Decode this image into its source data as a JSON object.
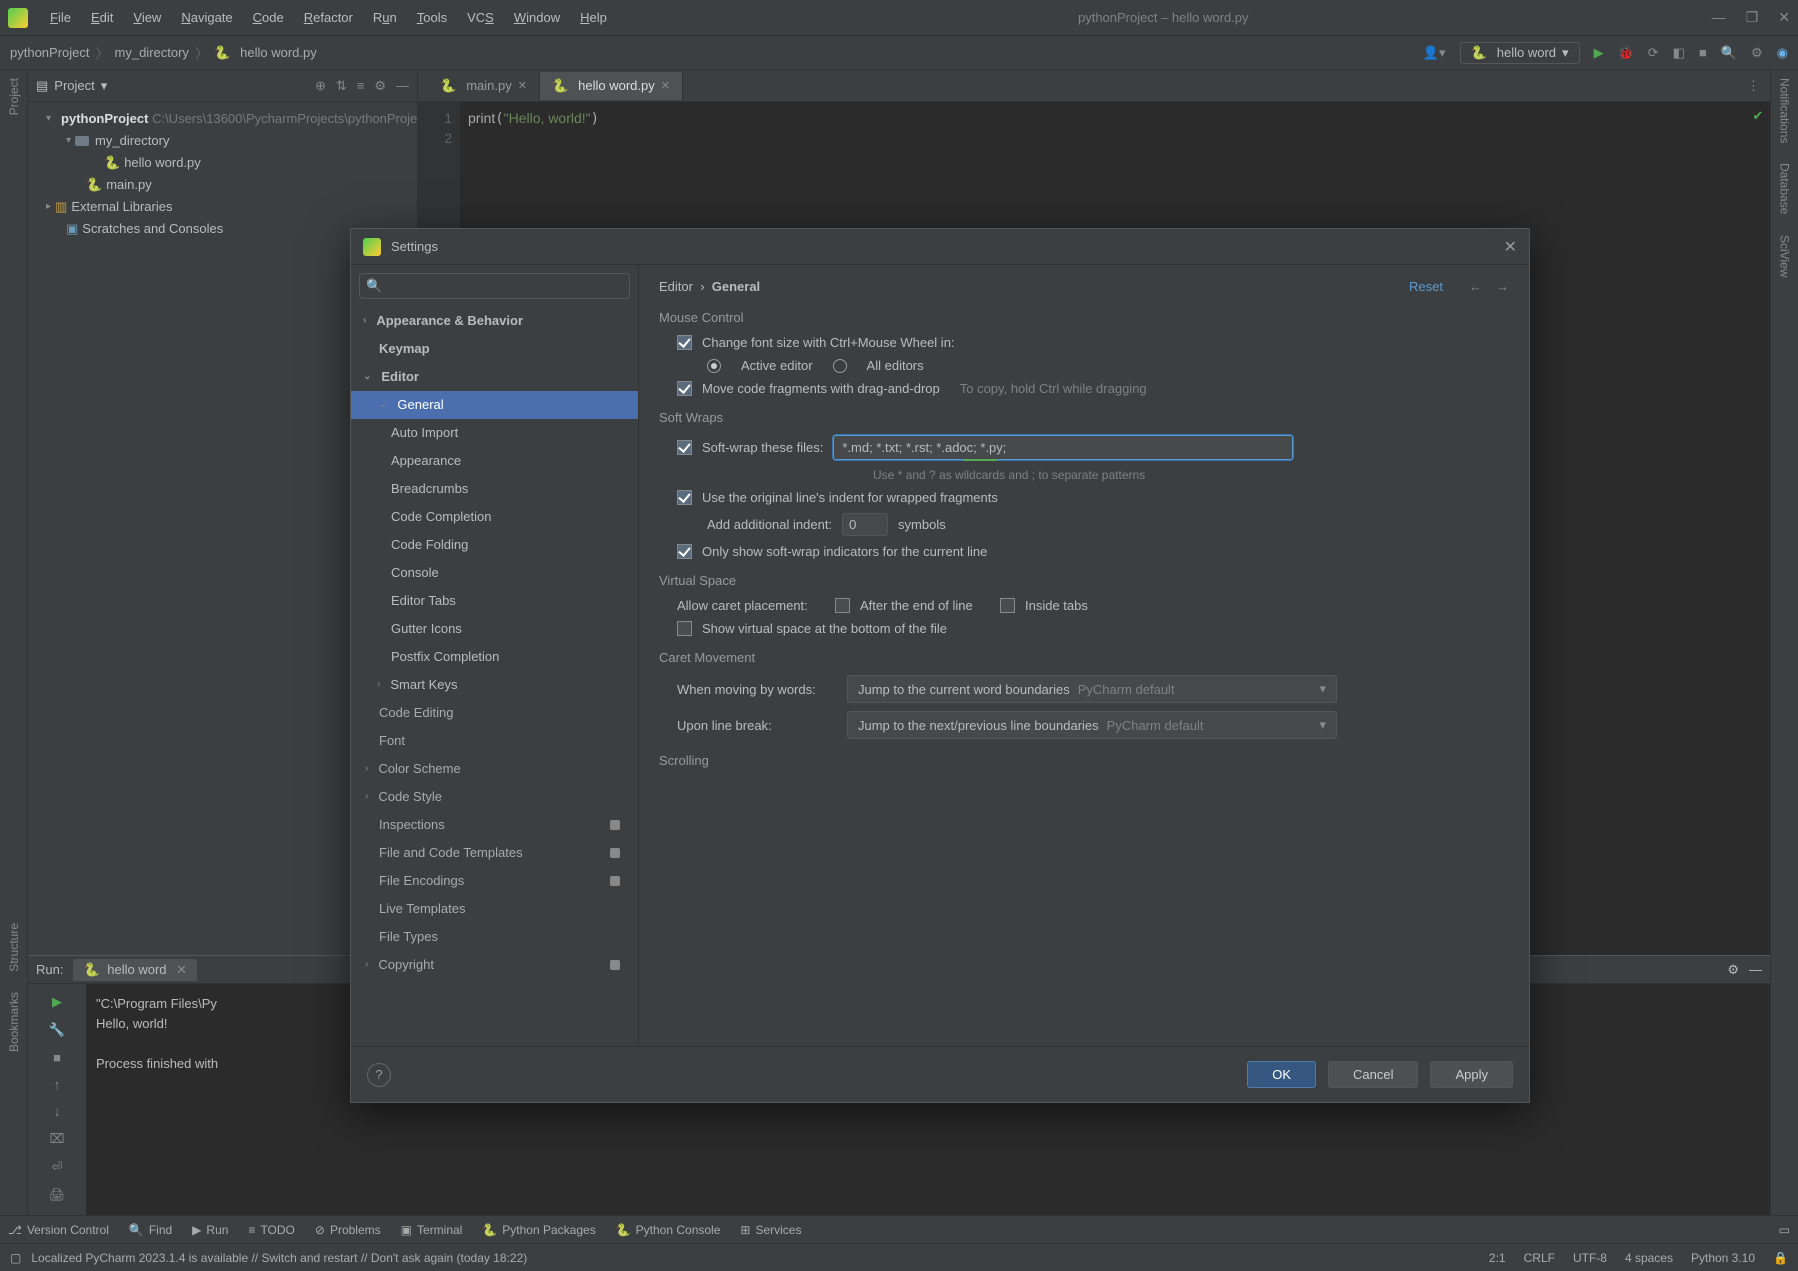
{
  "menu": {
    "file": "File",
    "edit": "Edit",
    "view": "View",
    "navigate": "Navigate",
    "code": "Code",
    "refactor": "Refactor",
    "run": "Run",
    "tools": "Tools",
    "vcs": "VCS",
    "window": "Window",
    "help": "Help"
  },
  "title": "pythonProject – hello word.py",
  "breadcrumbs": {
    "root": "pythonProject",
    "dir": "my_directory",
    "file": "hello word.py"
  },
  "runconfig": "hello word",
  "project": {
    "header": "Project",
    "root": "pythonProject",
    "rootPath": "C:\\Users\\13600\\PycharmProjects\\pythonProject",
    "dir": "my_directory",
    "file1": "hello word.py",
    "file2": "main.py",
    "ext": "External Libraries",
    "scratch": "Scratches and Consoles"
  },
  "tabs": {
    "t1": "main.py",
    "t2": "hello word.py"
  },
  "code": {
    "ln1": "1",
    "ln2": "2",
    "call": "print",
    "str": "\"Hello, world!\""
  },
  "run": {
    "label": "Run:",
    "name": "hello word",
    "line1": "\"C:\\Program Files\\Py",
    "line2": "Hello, world!",
    "line3": "Process finished with"
  },
  "bottom": {
    "vc": "Version Control",
    "find": "Find",
    "run": "Run",
    "todo": "TODO",
    "problems": "Problems",
    "terminal": "Terminal",
    "pkg": "Python Packages",
    "console": "Python Console",
    "svc": "Services"
  },
  "status": {
    "msg": "Localized PyCharm 2023.1.4 is available // Switch and restart // Don't ask again (today 18:22)",
    "pos": "2:1",
    "crlf": "CRLF",
    "enc": "UTF-8",
    "indent": "4 spaces",
    "py": "Python 3.10"
  },
  "sidebars": {
    "project": "Project",
    "structure": "Structure",
    "bookmarks": "Bookmarks",
    "notifications": "Notifications",
    "database": "Database",
    "sciview": "SciView"
  },
  "dialog": {
    "title": "Settings",
    "searchPlaceholder": "",
    "nav": {
      "appearance": "Appearance & Behavior",
      "keymap": "Keymap",
      "editor": "Editor",
      "general": "General",
      "autoimport": "Auto Import",
      "appearance2": "Appearance",
      "breadcrumbs": "Breadcrumbs",
      "completion": "Code Completion",
      "folding": "Code Folding",
      "console": "Console",
      "editortabs": "Editor Tabs",
      "gutter": "Gutter Icons",
      "postfix": "Postfix Completion",
      "smart": "Smart Keys",
      "codeediting": "Code Editing",
      "font": "Font",
      "colorscheme": "Color Scheme",
      "codestyle": "Code Style",
      "inspections": "Inspections",
      "filetemplates": "File and Code Templates",
      "fileenc": "File Encodings",
      "livetemplates": "Live Templates",
      "filetypes": "File Types",
      "copyright": "Copyright"
    },
    "crumb1": "Editor",
    "crumb2": "General",
    "reset": "Reset",
    "mouse": {
      "title": "Mouse Control",
      "chk1": "Change font size with Ctrl+Mouse Wheel in:",
      "r1": "Active editor",
      "r2": "All editors",
      "chk2": "Move code fragments with drag-and-drop",
      "hint2": "To copy, hold Ctrl while dragging"
    },
    "wrap": {
      "title": "Soft Wraps",
      "chk1": "Soft-wrap these files:",
      "value": "*.md; *.txt; *.rst; *.adoc; *.py;",
      "hint": "Use * and ? as wildcards and ; to separate patterns",
      "chk2": "Use the original line's indent for wrapped fragments",
      "indentlbl": "Add additional indent:",
      "indentval": "0",
      "symbols": "symbols",
      "chk3": "Only show soft-wrap indicators for the current line"
    },
    "virtual": {
      "title": "Virtual Space",
      "caret": "Allow caret placement:",
      "c1": "After the end of line",
      "c2": "Inside tabs",
      "show": "Show virtual space at the bottom of the file"
    },
    "caretm": {
      "title": "Caret Movement",
      "l1": "When moving by words:",
      "v1": "Jump to the current word boundaries",
      "d": "PyCharm default",
      "l2": "Upon line break:",
      "v2": "Jump to the next/previous line boundaries"
    },
    "scroll": {
      "title": "Scrolling"
    },
    "buttons": {
      "ok": "OK",
      "cancel": "Cancel",
      "apply": "Apply"
    }
  }
}
